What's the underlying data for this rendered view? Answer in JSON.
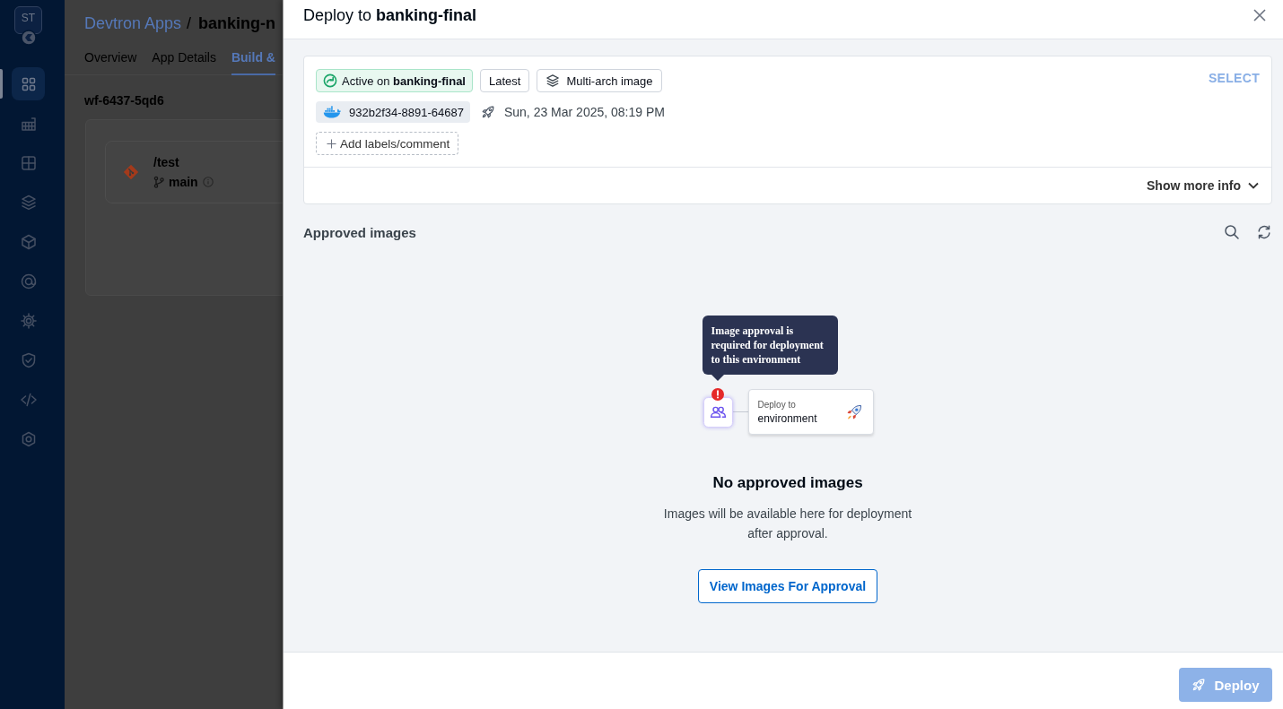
{
  "sidebar": {
    "logo": "ST",
    "items": [
      {
        "selected": true
      },
      {
        "selected": false
      },
      {
        "selected": false
      },
      {
        "selected": false
      },
      {
        "selected": false
      },
      {
        "selected": false
      },
      {
        "selected": false
      },
      {
        "selected": false
      },
      {
        "selected": false
      },
      {
        "selected": false
      }
    ]
  },
  "background_app": {
    "breadcrumb": {
      "parent": "Devtron Apps",
      "separator": "/",
      "current": "banking-n"
    },
    "tabs": [
      {
        "label": "Overview",
        "selected": false
      },
      {
        "label": "App Details",
        "selected": false
      },
      {
        "label": "Build &",
        "selected": true
      }
    ],
    "workflow": {
      "name": "wf-6437-5qd6",
      "source": {
        "path": "/test",
        "branch": "main"
      }
    }
  },
  "modal": {
    "title": "Deploy to **banking-final**",
    "image_card": {
      "tags": [
        {
          "kind": "active",
          "text": "Active on **banking-final**"
        },
        {
          "kind": "plain",
          "text": "Latest"
        },
        {
          "kind": "multiarch",
          "text": "Multi-arch image"
        }
      ],
      "select": {
        "label": "SELECT",
        "disabled": true
      },
      "digest": "932b2f34-8891-64687",
      "deployed_at": "Sun, 23 Mar 2025, 08:19 PM",
      "add_labels": "Add labels/comment",
      "show_more": "Show more info"
    },
    "approved_images": {
      "title": "Approved images",
      "empty_state": {
        "tooltip": "Image approval is required for deployment to this environment",
        "node": {
          "caption": "Deploy to",
          "label": "environment"
        },
        "heading": "No approved images",
        "message": "Images will be available here for deployment after approval.",
        "action": "View Images For Approval"
      }
    },
    "footer": {
      "deploy": {
        "label": "Deploy",
        "disabled": true
      }
    }
  }
}
